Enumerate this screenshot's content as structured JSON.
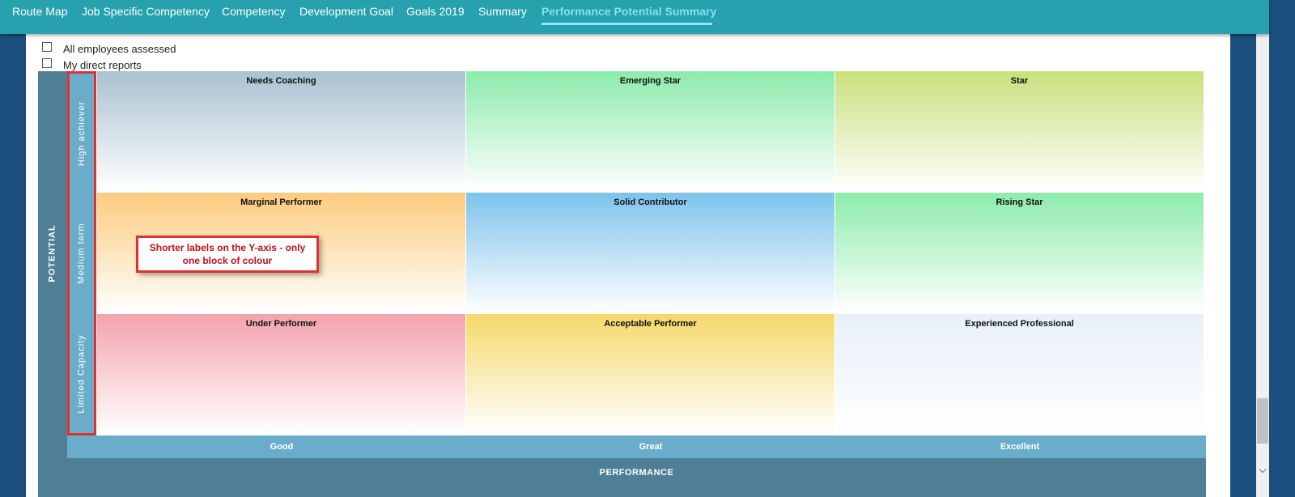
{
  "nav": {
    "tabs": [
      {
        "label": "Route Map"
      },
      {
        "label": "Job Specific Competency"
      },
      {
        "label": "Competency"
      },
      {
        "label": "Development Goal"
      },
      {
        "label": "Goals 2019"
      },
      {
        "label": "Summary"
      },
      {
        "label": "Performance Potential Summary",
        "active": true
      }
    ]
  },
  "filters": [
    {
      "label": "All employees assessed",
      "checked": false
    },
    {
      "label": "My direct reports",
      "checked": false
    }
  ],
  "matrix": {
    "y_axis_title": "POTENTIAL",
    "x_axis_title": "PERFORMANCE",
    "rows": [
      "High achiever",
      "Medium term",
      "Limited Capacity"
    ],
    "columns": [
      "Good",
      "Great",
      "Excellent"
    ],
    "cells": [
      [
        {
          "title": "Needs Coaching",
          "color": "#a9c2d0"
        },
        {
          "title": "Emerging Star",
          "color": "#8debab"
        },
        {
          "title": "Star",
          "color": "#c9e07c"
        }
      ],
      [
        {
          "title": "Marginal Performer",
          "color": "#fccb7e"
        },
        {
          "title": "Solid Contributor",
          "color": "#7dc3ec"
        },
        {
          "title": "Rising Star",
          "color": "#8debab"
        }
      ],
      [
        {
          "title": "Under Performer",
          "color": "#f4a2ad"
        },
        {
          "title": "Acceptable Performer",
          "color": "#f4d96a"
        },
        {
          "title": "Experienced Professional",
          "color": "#e8f0f8"
        }
      ]
    ]
  },
  "callout": {
    "text": "Shorter labels on the Y-axis - only one block of colour"
  },
  "colors": {
    "nav": "#26a1ad",
    "active_tab": "#7fe3f0",
    "axis": "#6aadca",
    "axis_dark": "#4f7f96",
    "highlight": "#e23030"
  }
}
